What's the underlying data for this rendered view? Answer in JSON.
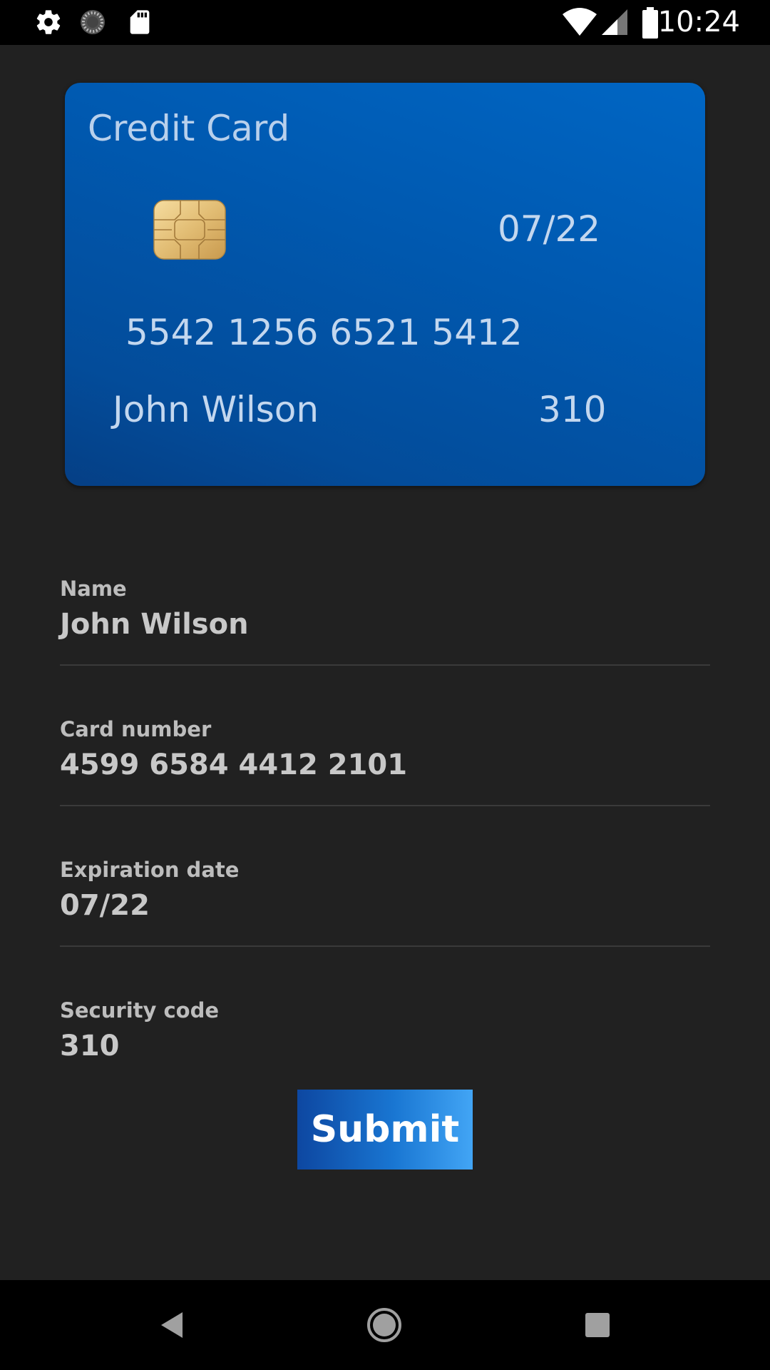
{
  "status_bar": {
    "time": "10:24",
    "left_icons": [
      "settings-icon",
      "sync-icon",
      "sd-card-icon"
    ],
    "right_icons": [
      "wifi-icon",
      "signal-icon",
      "battery-icon"
    ]
  },
  "card": {
    "title": "Credit Card",
    "expiry": "07/22",
    "number": "5542 1256 6521 5412",
    "holder": "John Wilson",
    "cvv": "310",
    "colors": {
      "gradient_start": "#0066c4",
      "gradient_end": "#053f85",
      "text": "#c3d7ef"
    }
  },
  "form": {
    "name": {
      "label": "Name",
      "value": "John Wilson"
    },
    "card_number": {
      "label": "Card number",
      "value": "4599 6584 4412 2101"
    },
    "expiration": {
      "label": "Expiration date",
      "value": "07/22"
    },
    "security": {
      "label": "Security code",
      "value": "310"
    }
  },
  "submit": {
    "label": "Submit"
  },
  "nav_bar": {
    "buttons": [
      "back-icon",
      "home-icon",
      "recents-icon"
    ]
  },
  "colors": {
    "background": "#212121",
    "accent": "#1976d2"
  }
}
